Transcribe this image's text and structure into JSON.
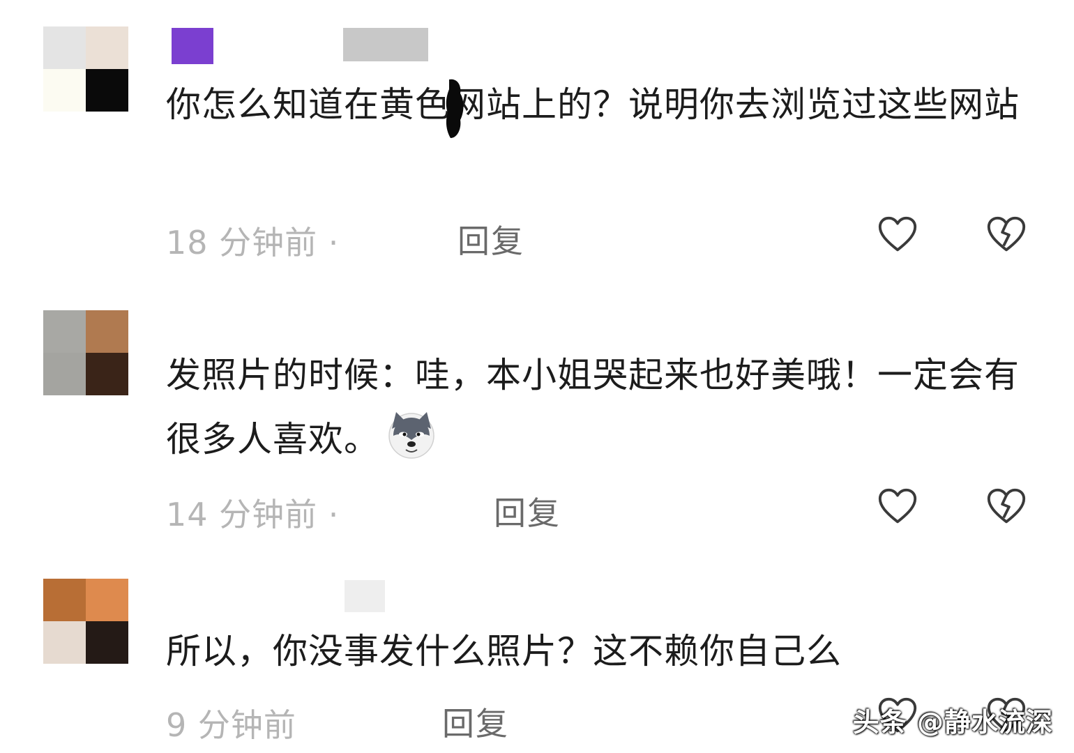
{
  "comments": [
    {
      "text": "你怎么知道在黄色网站上的？说明你去浏览过这些网站",
      "time": "18 分钟前 ·",
      "reply_label": "回复",
      "like_icon": "heart-outline-icon",
      "dislike_icon": "broken-heart-icon",
      "avatar_colors": [
        "#e4e4e4",
        "#ebe0d6",
        "#fcfbf2",
        "#0a0a0a"
      ],
      "name_colors": [
        "#7b3fd0",
        "#c8c8c8"
      ]
    },
    {
      "text": "发照片的时候：哇，本小姐哭起来也好美哦！一定会有很多人喜欢。",
      "time": "14 分钟前 ·",
      "reply_label": "回复",
      "emoji": "husky-emoji",
      "like_icon": "heart-outline-icon",
      "dislike_icon": "broken-heart-icon",
      "avatar_colors": [
        "#a8a8a4",
        "#b07a50",
        "#a4a4a0",
        "#3a2418"
      ]
    },
    {
      "text": "所以，你没事发什么照片？这不赖你自己么",
      "time": "9 分钟前",
      "reply_label": "回复",
      "like_icon": "heart-outline-icon",
      "dislike_icon": "broken-heart-icon",
      "avatar_colors": [
        "#b86e35",
        "#de8a4e",
        "#e6dad0",
        "#241a16"
      ],
      "name_colors": [
        "#eeeeee"
      ]
    }
  ],
  "watermark": "头条 @静水流深",
  "colors": {
    "text": "#1c1c1c",
    "meta": "#b5b5b5",
    "reply": "#6a6a6a",
    "icon": "#3a3a3a"
  }
}
